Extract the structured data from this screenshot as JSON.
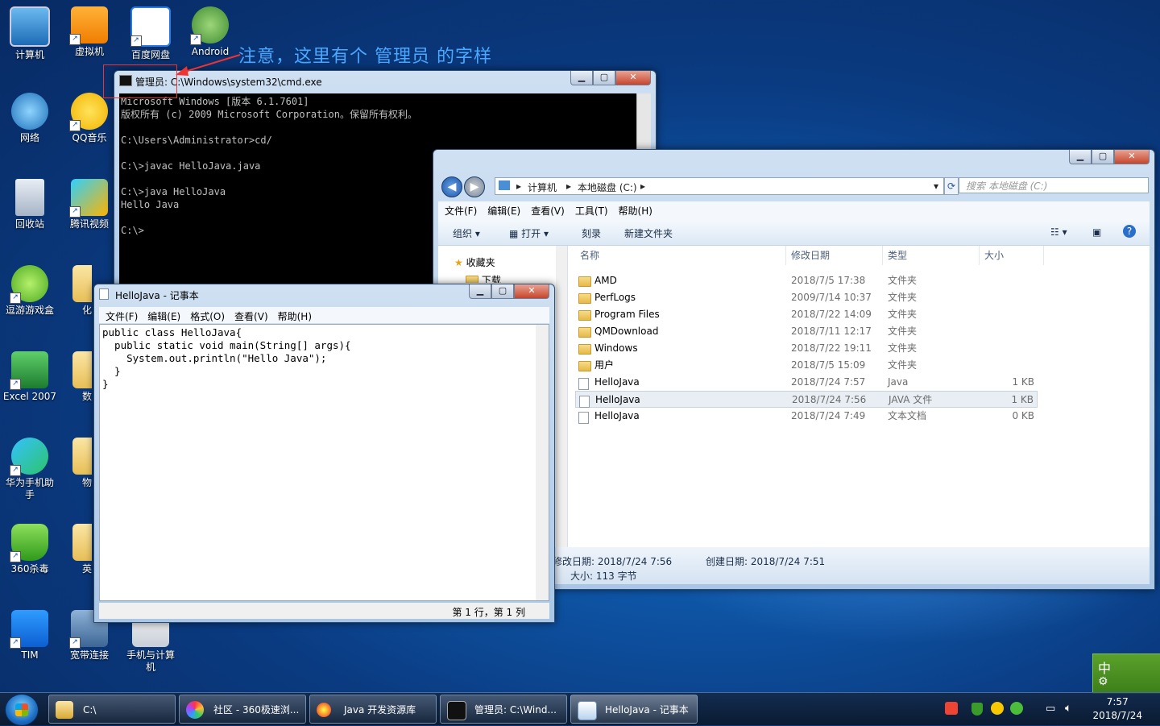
{
  "desktop": {
    "annotation": "注意，这里有个 管理员 的字样",
    "icons": [
      {
        "label": "计算机"
      },
      {
        "label": "虚拟机"
      },
      {
        "label": "百度网盘"
      },
      {
        "label": "Android Studio"
      },
      {
        "label": "网络"
      },
      {
        "label": "QQ音乐"
      },
      {
        "label": "回收站"
      },
      {
        "label": "腾讯视频"
      },
      {
        "label": "逗游游戏盒"
      },
      {
        "label": "化"
      },
      {
        "label": "Excel 2007"
      },
      {
        "label": "数"
      },
      {
        "label": "华为手机助手"
      },
      {
        "label": "物"
      },
      {
        "label": "360杀毒"
      },
      {
        "label": "英"
      },
      {
        "label": "TIM"
      },
      {
        "label": "宽带连接"
      },
      {
        "label": "手机与计算机"
      }
    ]
  },
  "cmd": {
    "title": "管理员: C:\\Windows\\system32\\cmd.exe",
    "lines": [
      "Microsoft Windows [版本 6.1.7601]",
      "版权所有 (c) 2009 Microsoft Corporation。保留所有权利。",
      "",
      "C:\\Users\\Administrator>cd/",
      "",
      "C:\\>javac HelloJava.java",
      "",
      "C:\\>java HelloJava",
      "Hello Java",
      "",
      "C:\\>"
    ]
  },
  "explorer": {
    "address": {
      "seg1": "计算机",
      "seg2": "本地磁盘 (C:)"
    },
    "search_placeholder": "搜索 本地磁盘 (C:)",
    "menu": [
      "文件(F)",
      "编辑(E)",
      "查看(V)",
      "工具(T)",
      "帮助(H)"
    ],
    "toolbar": {
      "organize": "组织",
      "open": "打开",
      "burn": "刻录",
      "new_folder": "新建文件夹"
    },
    "nav": {
      "favorites": "收藏夹",
      "downloads": "下载"
    },
    "columns": {
      "name": "名称",
      "date": "修改日期",
      "type": "类型",
      "size": "大小"
    },
    "rows": [
      {
        "name": "AMD",
        "date": "2018/7/5 17:38",
        "type": "文件夹",
        "size": "",
        "kind": "folder"
      },
      {
        "name": "PerfLogs",
        "date": "2009/7/14 10:37",
        "type": "文件夹",
        "size": "",
        "kind": "folder"
      },
      {
        "name": "Program Files",
        "date": "2018/7/22 14:09",
        "type": "文件夹",
        "size": "",
        "kind": "folder"
      },
      {
        "name": "QMDownload",
        "date": "2018/7/11 12:17",
        "type": "文件夹",
        "size": "",
        "kind": "folder"
      },
      {
        "name": "Windows",
        "date": "2018/7/22 19:11",
        "type": "文件夹",
        "size": "",
        "kind": "folder"
      },
      {
        "name": "用户",
        "date": "2018/7/5 15:09",
        "type": "文件夹",
        "size": "",
        "kind": "folder"
      },
      {
        "name": "HelloJava",
        "date": "2018/7/24 7:57",
        "type": "Java",
        "size": "1 KB",
        "kind": "file"
      },
      {
        "name": "HelloJava",
        "date": "2018/7/24 7:56",
        "type": "JAVA 文件",
        "size": "1 KB",
        "kind": "file",
        "selected": true
      },
      {
        "name": "HelloJava",
        "date": "2018/7/24 7:49",
        "type": "文本文档",
        "size": "0 KB",
        "kind": "file"
      }
    ],
    "status": {
      "modified": "修改日期: 2018/7/24 7:56",
      "created": "创建日期: 2018/7/24 7:51",
      "size": "大小: 113 字节"
    }
  },
  "notepad": {
    "title": "HelloJava - 记事本",
    "menu": [
      "文件(F)",
      "编辑(E)",
      "格式(O)",
      "查看(V)",
      "帮助(H)"
    ],
    "content": "public class HelloJava{\n  public static void main(String[] args){\n    System.out.println(\"Hello Java\");\n  }\n}",
    "status": "第 1 行，第 1 列"
  },
  "taskbar": {
    "items": [
      {
        "label": "C:\\"
      },
      {
        "label": "社区 - 360极速浏..."
      },
      {
        "label": "Java 开发资源库"
      },
      {
        "label": "管理员: C:\\Wind..."
      },
      {
        "label": "HelloJava - 记事本"
      }
    ],
    "ime": "中",
    "clock": {
      "time": "7:57",
      "date": "2018/7/24"
    }
  }
}
